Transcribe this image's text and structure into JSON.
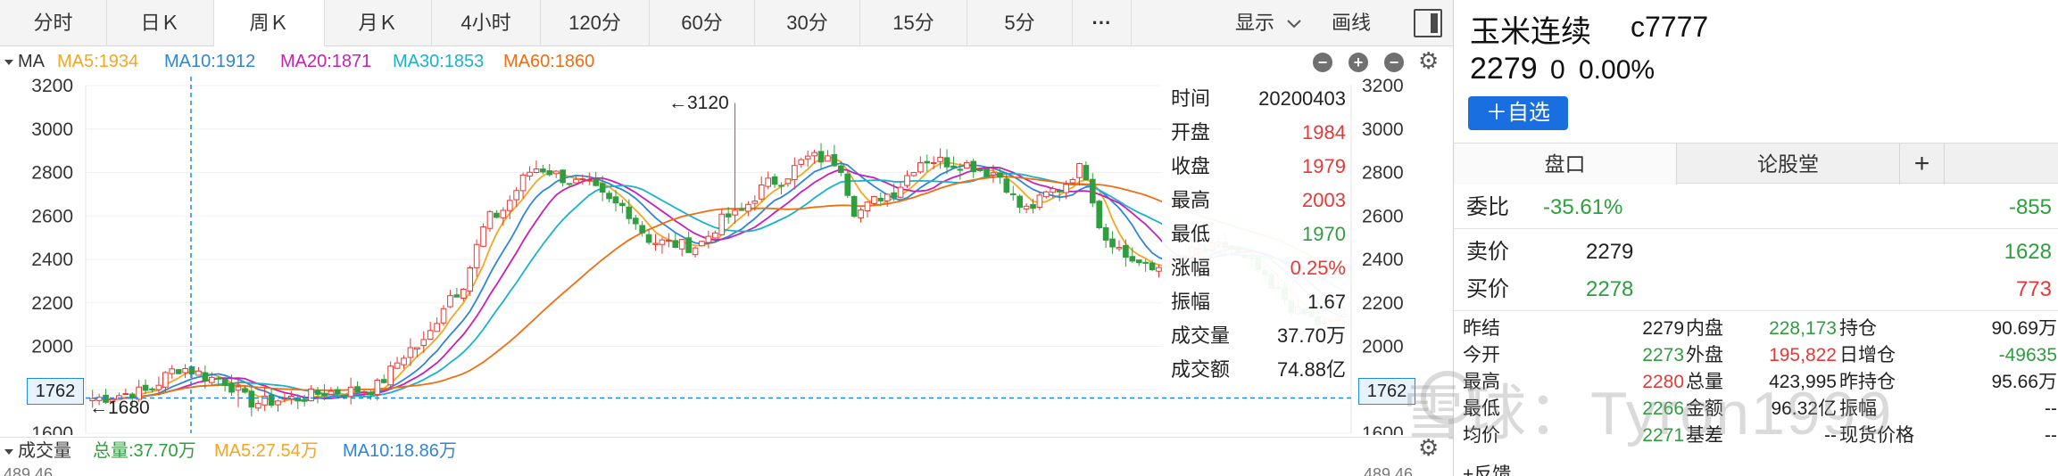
{
  "tabs": [
    {
      "label": "分时",
      "active": false
    },
    {
      "label": "日Ｋ",
      "active": false
    },
    {
      "label": "周Ｋ",
      "active": true
    },
    {
      "label": "月Ｋ",
      "active": false
    },
    {
      "label": "4小时",
      "active": false
    },
    {
      "label": "120分",
      "active": false
    },
    {
      "label": "60分",
      "active": false
    },
    {
      "label": "30分",
      "active": false
    },
    {
      "label": "15分",
      "active": false
    },
    {
      "label": "5分",
      "active": false
    },
    {
      "label": "···",
      "active": false
    }
  ],
  "toolbar": {
    "display_label": "显示",
    "draw_label": "画线"
  },
  "ma_legend": {
    "label": "MA",
    "items": [
      {
        "text": "MA5:1934",
        "color": "#f5a623"
      },
      {
        "text": "MA10:1912",
        "color": "#2f86d6"
      },
      {
        "text": "MA20:1871",
        "color": "#c71fb8"
      },
      {
        "text": "MA30:1853",
        "color": "#19b3c9"
      },
      {
        "text": "MA60:1860",
        "color": "#f06e12"
      }
    ]
  },
  "chart_data": {
    "type": "candlestick",
    "period": "weekly",
    "ylim": [
      1600,
      3200
    ],
    "y_ticks": [
      "3200",
      "3000",
      "2800",
      "2600",
      "2400",
      "2200",
      "2000",
      "1800",
      "1600"
    ],
    "annotations": {
      "max_label": "←3120",
      "max_value": 3120,
      "min_label": "←1680",
      "min_value": 1680
    },
    "crosshair_price": "1762",
    "colors": {
      "up": "#e53935",
      "down": "#2e9e3e"
    },
    "anchors": [
      {
        "t": 0,
        "v": 1760
      },
      {
        "t": 0.04,
        "v": 1790
      },
      {
        "t": 0.07,
        "v": 1900
      },
      {
        "t": 0.1,
        "v": 1850
      },
      {
        "t": 0.13,
        "v": 1740
      },
      {
        "t": 0.16,
        "v": 1760
      },
      {
        "t": 0.19,
        "v": 1790
      },
      {
        "t": 0.22,
        "v": 1800
      },
      {
        "t": 0.26,
        "v": 2000
      },
      {
        "t": 0.29,
        "v": 2250
      },
      {
        "t": 0.32,
        "v": 2600
      },
      {
        "t": 0.355,
        "v": 2820
      },
      {
        "t": 0.39,
        "v": 2750
      },
      {
        "t": 0.42,
        "v": 2650
      },
      {
        "t": 0.45,
        "v": 2480
      },
      {
        "t": 0.48,
        "v": 2460
      },
      {
        "t": 0.51,
        "v": 2600
      },
      {
        "t": 0.545,
        "v": 2760
      },
      {
        "t": 0.575,
        "v": 2870
      },
      {
        "t": 0.595,
        "v": 2850
      },
      {
        "t": 0.61,
        "v": 2620
      },
      {
        "t": 0.635,
        "v": 2700
      },
      {
        "t": 0.665,
        "v": 2860
      },
      {
        "t": 0.695,
        "v": 2840
      },
      {
        "t": 0.72,
        "v": 2800
      },
      {
        "t": 0.745,
        "v": 2630
      },
      {
        "t": 0.77,
        "v": 2720
      },
      {
        "t": 0.79,
        "v": 2820
      },
      {
        "t": 0.81,
        "v": 2500
      },
      {
        "t": 0.83,
        "v": 2400
      },
      {
        "t": 0.845,
        "v": 2350
      },
      {
        "t": 0.86,
        "v": 2390
      },
      {
        "t": 0.885,
        "v": 2440
      },
      {
        "t": 0.905,
        "v": 2460
      },
      {
        "t": 0.925,
        "v": 2380
      },
      {
        "t": 0.945,
        "v": 2250
      },
      {
        "t": 0.965,
        "v": 2150
      },
      {
        "t": 0.985,
        "v": 2090
      },
      {
        "t": 1.0,
        "v": 2150
      }
    ],
    "series": [
      {
        "name": "MA5",
        "color": "#f5a623",
        "lag": 2
      },
      {
        "name": "MA10",
        "color": "#2f86d6",
        "lag": 4
      },
      {
        "name": "MA20",
        "color": "#c71fb8",
        "lag": 6
      },
      {
        "name": "MA30",
        "color": "#19b3c9",
        "lag": 9
      },
      {
        "name": "MA60",
        "color": "#f06e12",
        "lag": 18
      }
    ]
  },
  "info_panel": {
    "rows": [
      {
        "label": "时间",
        "value": "20200403",
        "color": "#222222"
      },
      {
        "label": "开盘",
        "value": "1984",
        "color": "#e53935"
      },
      {
        "label": "收盘",
        "value": "1979",
        "color": "#e53935"
      },
      {
        "label": "最高",
        "value": "2003",
        "color": "#e53935"
      },
      {
        "label": "最低",
        "value": "1970",
        "color": "#2e9e3e"
      },
      {
        "label": "涨幅",
        "value": "0.25%",
        "color": "#e53935"
      },
      {
        "label": "振幅",
        "value": "1.67",
        "color": "#222222"
      },
      {
        "label": "成交量",
        "value": "37.70万",
        "color": "#222222"
      },
      {
        "label": "成交额",
        "value": "74.88亿",
        "color": "#222222"
      }
    ]
  },
  "volume_header": {
    "title": "成交量",
    "total": "总量:37.70万",
    "ma5": "MA5:27.54万",
    "ma10": "MA10:18.86万",
    "axis_value": "489.46"
  },
  "stock": {
    "name": "玉米连续",
    "code": "c7777",
    "price": "2279",
    "change": "0",
    "change_pct": "0.00%",
    "add_watch": "＋自选"
  },
  "right_tabs": {
    "tab1": "盘口",
    "tab2": "论股堂",
    "plus": "+"
  },
  "quote": {
    "weibi_label": "委比",
    "weibi_value": "-35.61%",
    "weibi_diff": "-855",
    "sell_label": "卖价",
    "sell_price": "2279",
    "sell_volume": "1628",
    "buy_label": "买价",
    "buy_price": "2278",
    "buy_volume": "773"
  },
  "grid": [
    {
      "l1": "昨结",
      "v1": "2279",
      "l2": "内盘",
      "v2": "228,173",
      "l3": "持仓",
      "v3": "90.69万",
      "c1": "#222222",
      "c2": "#2e9e3e",
      "c3": "#222222"
    },
    {
      "l1": "今开",
      "v1": "2273",
      "l2": "外盘",
      "v2": "195,822",
      "l3": "日增仓",
      "v3": "-49635",
      "c1": "#2e9e3e",
      "c2": "#e53935",
      "c3": "#2e9e3e"
    },
    {
      "l1": "最高",
      "v1": "2280",
      "l2": "总量",
      "v2": "423,995",
      "l3": "昨持仓",
      "v3": "95.66万",
      "c1": "#e53935",
      "c2": "#222222",
      "c3": "#222222"
    },
    {
      "l1": "最低",
      "v1": "2266",
      "l2": "金额",
      "v2": "96.32亿",
      "l3": "振幅",
      "v3": "--",
      "c1": "#2e9e3e",
      "c2": "#222222",
      "c3": "#222222"
    },
    {
      "l1": "均价",
      "v1": "2271",
      "l2": "基差",
      "v2": "--",
      "l3": "现货价格",
      "v3": "--",
      "c1": "#2e9e3e",
      "c2": "#222222",
      "c3": "#222222"
    }
  ],
  "feedback_label": "+反馈",
  "watermark": "雪球：Tyron1999"
}
